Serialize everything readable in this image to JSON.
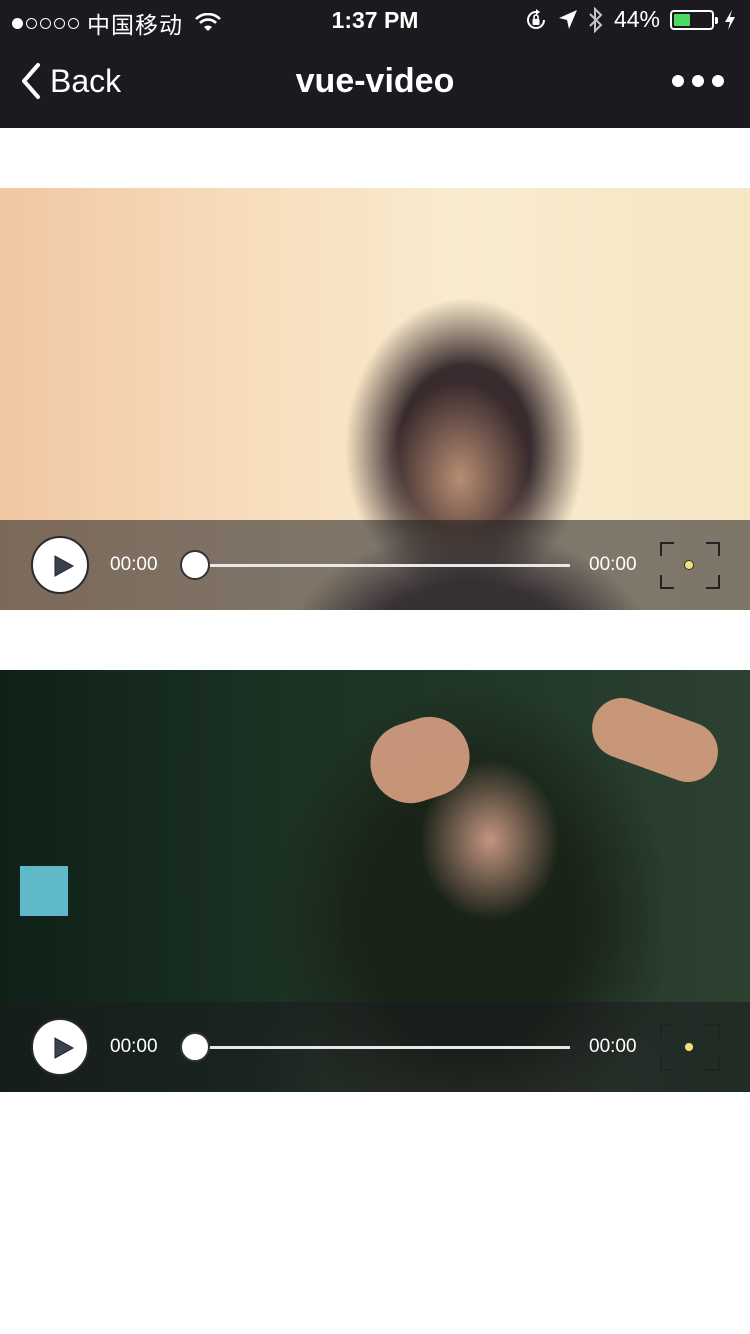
{
  "status_bar": {
    "carrier": "中国移动",
    "signal_bars": 1,
    "time": "1:37 PM",
    "battery_percent_label": "44%",
    "battery_level": 0.44,
    "icons": [
      "wifi-icon",
      "orientation-lock-icon",
      "location-arrow-icon",
      "bluetooth-icon",
      "charging-bolt-icon"
    ]
  },
  "nav": {
    "back_label": "Back",
    "title": "vue-video",
    "more_icon": "ellipsis-icon"
  },
  "videos": [
    {
      "current_time": "00:00",
      "duration": "00:00",
      "progress": 0
    },
    {
      "current_time": "00:00",
      "duration": "00:00",
      "progress": 0
    }
  ],
  "colors": {
    "nav_background": "#1b1a1f",
    "battery_fill": "#4cd964",
    "fullscreen_dot": "#f3e17e"
  }
}
